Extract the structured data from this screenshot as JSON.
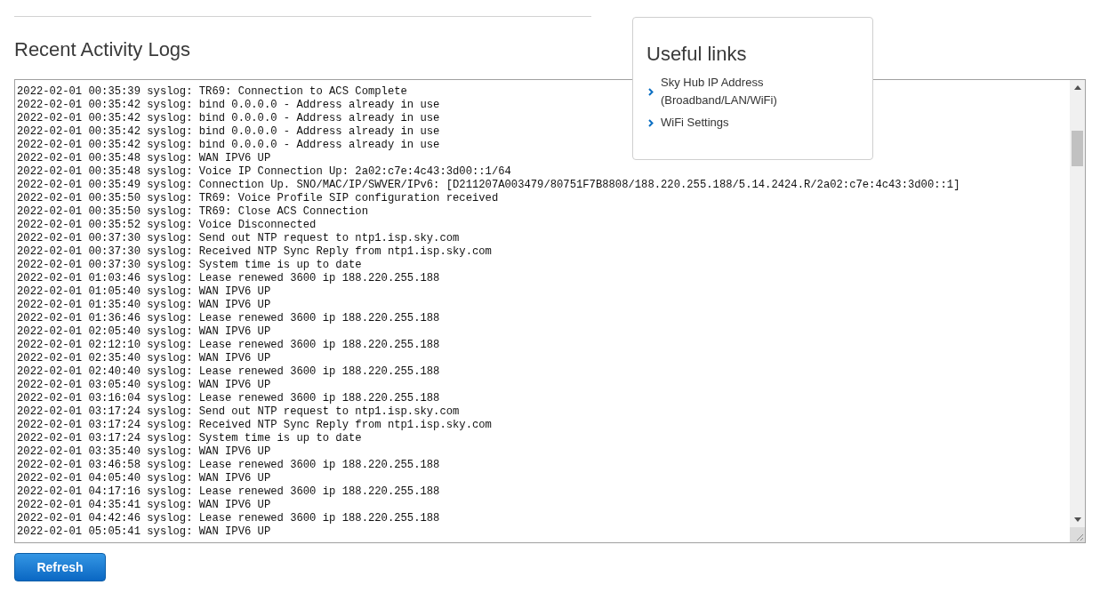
{
  "section": {
    "title": "Recent Activity Logs"
  },
  "useful_links": {
    "title": "Useful links",
    "links": [
      {
        "label": "Sky Hub IP Address (Broadband/LAN/WiFi)"
      },
      {
        "label": "WiFi Settings"
      }
    ]
  },
  "log": {
    "lines": [
      "2022-02-01 00:35:39 syslog: TR69: Connection to ACS Complete",
      "2022-02-01 00:35:42 syslog: bind 0.0.0.0 - Address already in use",
      "2022-02-01 00:35:42 syslog: bind 0.0.0.0 - Address already in use",
      "2022-02-01 00:35:42 syslog: bind 0.0.0.0 - Address already in use",
      "2022-02-01 00:35:42 syslog: bind 0.0.0.0 - Address already in use",
      "2022-02-01 00:35:48 syslog: WAN IPV6 UP",
      "2022-02-01 00:35:48 syslog: Voice IP Connection Up: 2a02:c7e:4c43:3d00::1/64",
      "2022-02-01 00:35:49 syslog: Connection Up. SNO/MAC/IP/SWVER/IPv6: [D211207A003479/80751F7B8808/188.220.255.188/5.14.2424.R/2a02:c7e:4c43:3d00::1]",
      "2022-02-01 00:35:50 syslog: TR69: Voice Profile SIP configuration received",
      "2022-02-01 00:35:50 syslog: TR69: Close ACS Connection",
      "2022-02-01 00:35:52 syslog: Voice Disconnected",
      "2022-02-01 00:37:30 syslog: Send out NTP request to ntp1.isp.sky.com",
      "2022-02-01 00:37:30 syslog: Received NTP Sync Reply from ntp1.isp.sky.com",
      "2022-02-01 00:37:30 syslog: System time is up to date",
      "2022-02-01 01:03:46 syslog: Lease renewed 3600 ip 188.220.255.188",
      "2022-02-01 01:05:40 syslog: WAN IPV6 UP",
      "2022-02-01 01:35:40 syslog: WAN IPV6 UP",
      "2022-02-01 01:36:46 syslog: Lease renewed 3600 ip 188.220.255.188",
      "2022-02-01 02:05:40 syslog: WAN IPV6 UP",
      "2022-02-01 02:12:10 syslog: Lease renewed 3600 ip 188.220.255.188",
      "2022-02-01 02:35:40 syslog: WAN IPV6 UP",
      "2022-02-01 02:40:40 syslog: Lease renewed 3600 ip 188.220.255.188",
      "2022-02-01 03:05:40 syslog: WAN IPV6 UP",
      "2022-02-01 03:16:04 syslog: Lease renewed 3600 ip 188.220.255.188",
      "2022-02-01 03:17:24 syslog: Send out NTP request to ntp1.isp.sky.com",
      "2022-02-01 03:17:24 syslog: Received NTP Sync Reply from ntp1.isp.sky.com",
      "2022-02-01 03:17:24 syslog: System time is up to date",
      "2022-02-01 03:35:40 syslog: WAN IPV6 UP",
      "2022-02-01 03:46:58 syslog: Lease renewed 3600 ip 188.220.255.188",
      "2022-02-01 04:05:40 syslog: WAN IPV6 UP",
      "2022-02-01 04:17:16 syslog: Lease renewed 3600 ip 188.220.255.188",
      "2022-02-01 04:35:41 syslog: WAN IPV6 UP",
      "2022-02-01 04:42:46 syslog: Lease renewed 3600 ip 188.220.255.188",
      "2022-02-01 05:05:41 syslog: WAN IPV6 UP"
    ]
  },
  "refresh_button": "Refresh"
}
